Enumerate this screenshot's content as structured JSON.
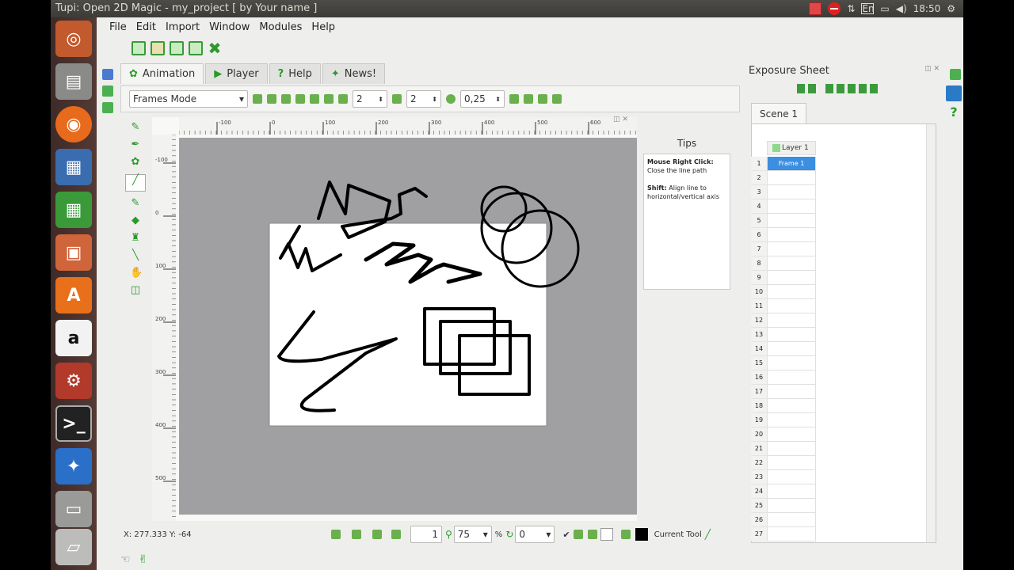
{
  "topbar": {
    "window_title": "Tupi: Open 2D Magic - my_project [ by Your name ]",
    "keyboard_layout": "En",
    "clock": "18:50"
  },
  "menu": [
    "File",
    "Edit",
    "Import",
    "Window",
    "Modules",
    "Help"
  ],
  "tabs": [
    {
      "label": "Animation",
      "icon": "animation-icon"
    },
    {
      "label": "Player",
      "icon": "play-icon"
    },
    {
      "label": "Help",
      "icon": "question-icon"
    },
    {
      "label": "News!",
      "icon": "news-icon"
    }
  ],
  "toolrow": {
    "mode": "Frames Mode",
    "onion_prev": "2",
    "onion_next": "2",
    "opacity": "0,25"
  },
  "ruler_h_ticks": [
    "-100",
    "0",
    "100",
    "200",
    "300",
    "400",
    "500",
    "600"
  ],
  "ruler_v_ticks": [
    "-100",
    "0",
    "100",
    "200",
    "300",
    "400",
    "500"
  ],
  "tips": {
    "title": "Tips",
    "line1_bold": "Mouse Right Click:",
    "line1": "Close the line path",
    "line2_bold": "Shift:",
    "line2": "Align line to horizontal/vertical axis"
  },
  "status": {
    "coords": "X: 277.333 Y: -64",
    "frame": "1",
    "zoom": "75",
    "rotation": "0",
    "current_tool": "Current Tool"
  },
  "exposure": {
    "title": "Exposure Sheet",
    "scene_tab": "Scene 1",
    "layer": "Layer 1",
    "frame_label": "Frame 1",
    "rows": [
      "1",
      "2",
      "3",
      "4",
      "5",
      "6",
      "7",
      "8",
      "9",
      "10",
      "11",
      "12",
      "13",
      "14",
      "15",
      "16",
      "17",
      "18",
      "19",
      "20",
      "21",
      "22",
      "23",
      "24",
      "25",
      "26",
      "27"
    ]
  },
  "colors": {
    "accent_green": "#2a9a2a",
    "selection_blue": "#3b8ee0",
    "stage_gray": "#a0a0a2"
  }
}
